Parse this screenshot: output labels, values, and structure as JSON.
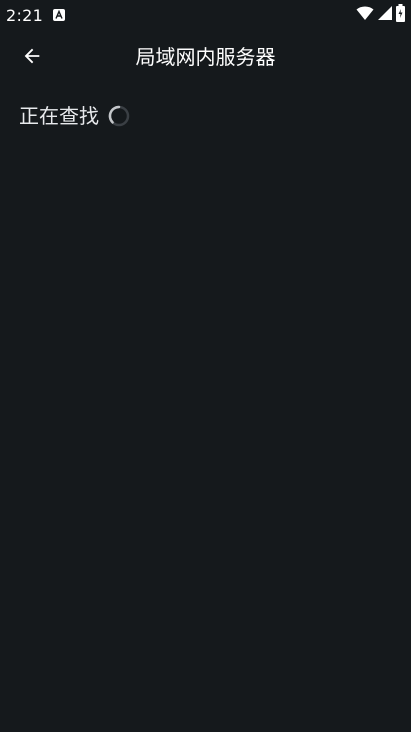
{
  "status_bar": {
    "time": "2:21",
    "notification_icon": "a-letter-icon",
    "wifi_icon": "wifi-icon",
    "signal_icon": "signal-icon",
    "battery_icon": "battery-icon"
  },
  "app_bar": {
    "back_icon": "arrow-back-icon",
    "title": "局域网内服务器"
  },
  "main": {
    "searching_label": "正在查找",
    "spinner_icon": "loading-spinner-icon"
  },
  "colors": {
    "background": "#15191c",
    "text": "#e8eaed",
    "spinner": "#9aa0a6"
  }
}
